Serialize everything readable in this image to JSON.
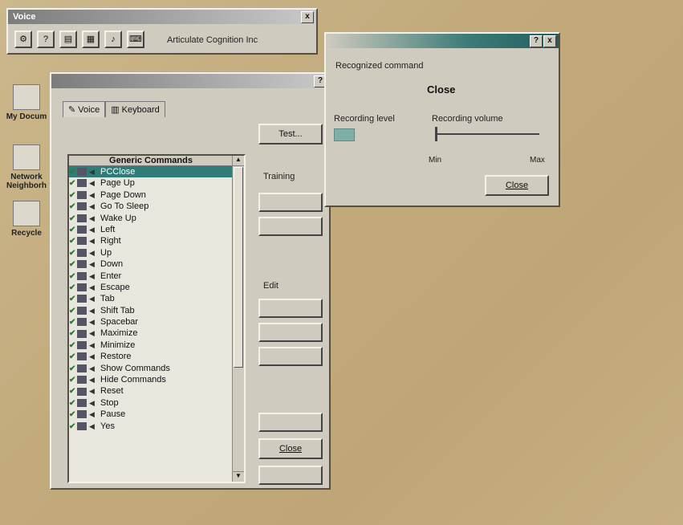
{
  "toolbar_window": {
    "title": "Voice",
    "company": "Articulate Cognition Inc",
    "close": "x"
  },
  "main_dialog": {
    "help": "?",
    "tabs": [
      "Voice",
      "Keyboard"
    ],
    "list_header": "Generic Commands",
    "commands": [
      "PCClose",
      "Page Up",
      "Page Down",
      "Go To Sleep",
      "Wake Up",
      "Left",
      "Right",
      "Up",
      "Down",
      "Enter",
      "Escape",
      "Tab",
      "Shift Tab",
      "Spacebar",
      "Maximize",
      "Minimize",
      "Restore",
      "Show Commands",
      "Hide Commands",
      "Reset",
      "Stop",
      "Pause",
      "Yes"
    ],
    "selected_index": 0,
    "test_button": "Test...",
    "training_label": "Training",
    "edit_label": "Edit",
    "close_button": "Close"
  },
  "recognition_dialog": {
    "help": "?",
    "close": "x",
    "recognized_label": "Recognized command",
    "recognized_value": "Close",
    "level_label": "Recording level",
    "volume_label": "Recording volume",
    "min_label": "Min",
    "max_label": "Max",
    "close_button": "Close"
  },
  "desktop_icons": [
    {
      "label": "My Docum",
      "icon": "document-icon"
    },
    {
      "label": "Network Neighborh",
      "icon": "network-icon"
    },
    {
      "label": "Recycle",
      "icon": "recycle-bin-icon"
    }
  ]
}
